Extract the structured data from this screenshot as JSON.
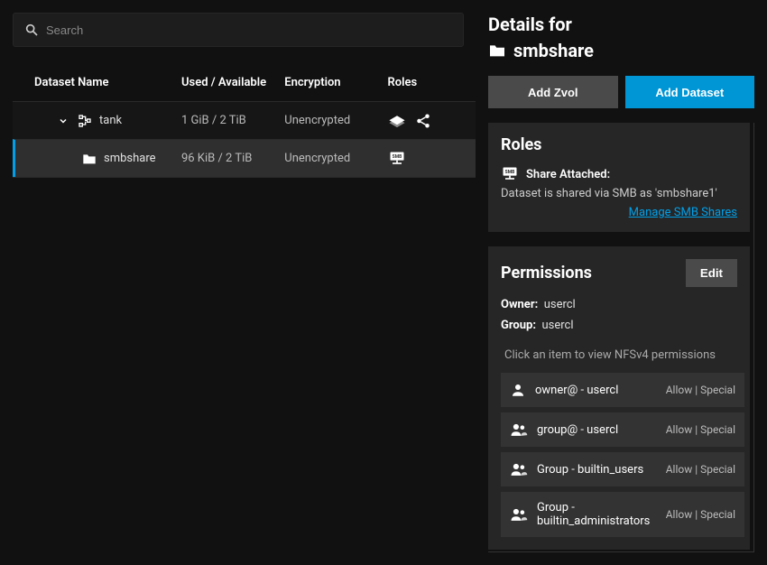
{
  "search": {
    "placeholder": "Search"
  },
  "table": {
    "headers": {
      "name": "Dataset Name",
      "used": "Used / Available",
      "encryption": "Encryption",
      "roles": "Roles"
    },
    "rows": [
      {
        "name": "tank",
        "used": "1 GiB / 2 TiB",
        "encryption": "Unencrypted"
      },
      {
        "name": "smbshare",
        "used": "96 KiB / 2 TiB",
        "encryption": "Unencrypted"
      }
    ]
  },
  "details": {
    "title": "Details for",
    "dataset": "smbshare",
    "add_zvol": "Add Zvol",
    "add_dataset": "Add Dataset"
  },
  "roles_card": {
    "title": "Roles",
    "share_attached": "Share Attached:",
    "share_desc": "Dataset is shared via SMB as 'smbshare1'",
    "manage_link": "Manage SMB Shares"
  },
  "perms_card": {
    "title": "Permissions",
    "edit": "Edit",
    "owner_label": "Owner:",
    "owner_value": "usercl",
    "group_label": "Group:",
    "group_value": "usercl",
    "hint": "Click an item to view NFSv4 permissions",
    "entries": [
      {
        "name": "owner@ - usercl",
        "mode": "Allow | Special",
        "type": "user"
      },
      {
        "name": "group@ - usercl",
        "mode": "Allow | Special",
        "type": "group"
      },
      {
        "name": "Group - builtin_users",
        "mode": "Allow | Special",
        "type": "group"
      },
      {
        "name": "Group - builtin_administrators",
        "mode": "Allow | Special",
        "type": "group"
      }
    ]
  }
}
